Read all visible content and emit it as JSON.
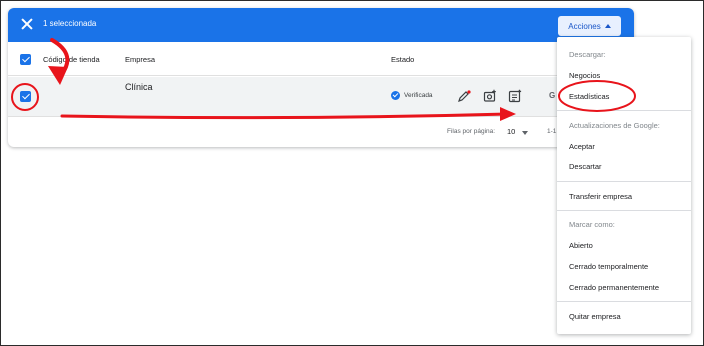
{
  "topbar": {
    "selected_text": "1 seleccionada",
    "acciones_label": "Acciones"
  },
  "table": {
    "headers": {
      "codigo": "Código de tienda",
      "empresa": "Empresa",
      "estado": "Estado"
    },
    "row": {
      "empresa": "Clínica",
      "estado": "Verificada",
      "extra_badge": "G"
    }
  },
  "footer": {
    "rows_per_page_label": "Filas por página:",
    "rows_per_page_value": "10",
    "range": "1-1"
  },
  "menu": {
    "descargar_header": "Descargar:",
    "negocios": "Negocios",
    "estadisticas": "Estadísticas",
    "actualizaciones_header": "Actualizaciones de Google:",
    "aceptar": "Aceptar",
    "descartar": "Descartar",
    "transferir": "Transferir empresa",
    "marcar_header": "Marcar como:",
    "abierto": "Abierto",
    "cerrado_temp": "Cerrado temporalmente",
    "cerrado_perm": "Cerrado permanentemente",
    "quitar": "Quitar empresa"
  },
  "icons": [
    "close-icon",
    "caret-up-icon",
    "checkbox-icon",
    "verified-icon",
    "edit-icon",
    "add-photo-icon",
    "post-icon",
    "dropdown-caret-icon"
  ],
  "colors": {
    "primary": "#1a73e8",
    "annotation": "#e8141b"
  }
}
